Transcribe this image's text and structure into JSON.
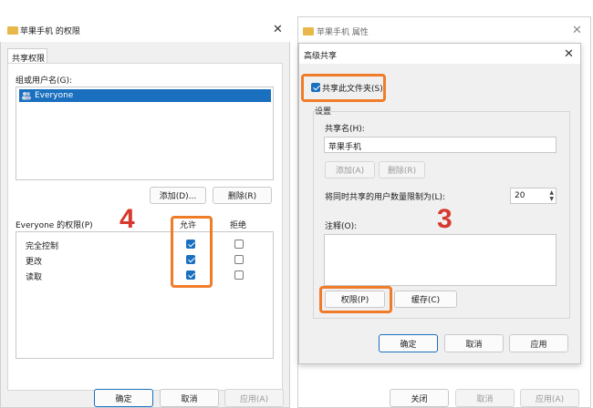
{
  "colors": {
    "accent": "#1a6fbf",
    "highlight": "#f07c2a",
    "annotation": "#d63a2f"
  },
  "left": {
    "title": "苹果手机 的权限",
    "tab": "共享权限",
    "group_label": "组或用户名(G):",
    "users": [
      "Everyone"
    ],
    "add_button": "添加(D)...",
    "remove_button": "删除(R)",
    "perm_label": "Everyone 的权限(P)",
    "allow_header": "允许",
    "deny_header": "拒绝",
    "permissions": [
      {
        "name": "完全控制",
        "allow": true,
        "deny": false
      },
      {
        "name": "更改",
        "allow": true,
        "deny": false
      },
      {
        "name": "读取",
        "allow": true,
        "deny": false
      }
    ],
    "ok_button": "确定",
    "cancel_button": "取消",
    "apply_button": "应用(A)",
    "step_number": "4"
  },
  "right": {
    "bg_title": "苹果手机 属性",
    "title": "高级共享",
    "share_checkbox_label": "共享此文件夹(S)",
    "settings_label": "设置",
    "share_name_label": "共享名(H):",
    "share_name_value": "苹果手机",
    "add_button": "添加(A)",
    "remove_button": "删除(R)",
    "user_limit_label": "将同时共享的用户数量限制为(L):",
    "user_limit_value": "20",
    "comment_label": "注释(O):",
    "permissions_button": "权限(P)",
    "cache_button": "缓存(C)",
    "ok_button": "确定",
    "cancel_button": "取消",
    "apply_button": "应用",
    "bg_close_button": "关闭",
    "bg_cancel_button": "取消",
    "bg_apply_button": "应用(A)",
    "step_number": "3"
  }
}
